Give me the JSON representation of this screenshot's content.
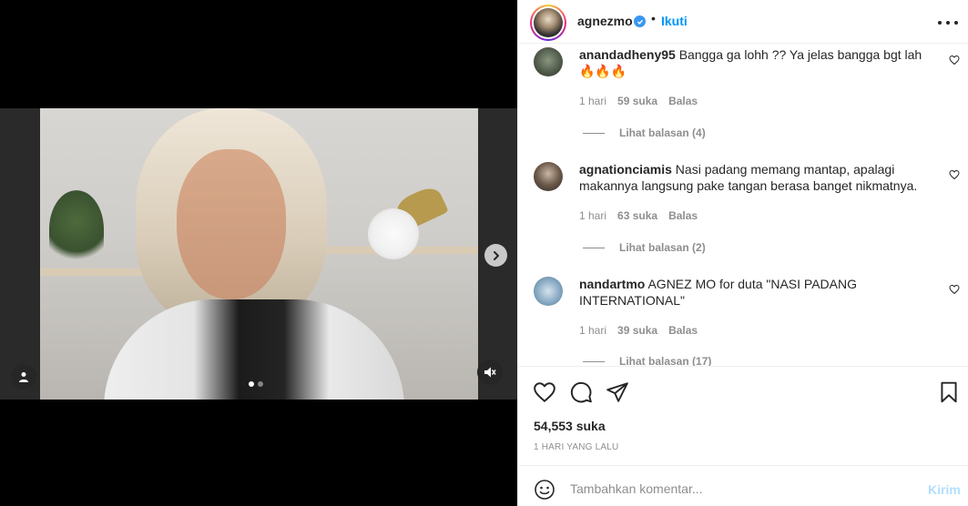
{
  "post": {
    "username": "agnezmo",
    "separator": "•",
    "follow_label": "Ikuti",
    "likes_label": "54,553 suka",
    "time_label": "1 HARI YANG LALU"
  },
  "comments": [
    {
      "username": "anandadheny95",
      "text": " Bangga ga lohh ?? Ya jelas bangga bgt lah 🔥🔥🔥",
      "time": "1 hari",
      "likes": "59 suka",
      "reply_label": "Balas",
      "view_replies": "Lihat balasan (4)"
    },
    {
      "username": "agnationciamis",
      "text": " Nasi padang memang mantap, apalagi makannya langsung pake tangan berasa banget nikmatnya.",
      "time": "1 hari",
      "likes": "63 suka",
      "reply_label": "Balas",
      "view_replies": "Lihat balasan (2)"
    },
    {
      "username": "nandartmo",
      "text": " AGNEZ MO for duta \"NASI PADANG INTERNATIONAL\"",
      "time": "1 hari",
      "likes": "39 suka",
      "reply_label": "Balas",
      "view_replies": "Lihat balasan (17)"
    }
  ],
  "composer": {
    "placeholder": "Tambahkan komentar...",
    "post_label": "Kirim"
  },
  "media": {
    "carousel_total": 2,
    "carousel_active": 1
  },
  "colors": {
    "accent": "#0095f6",
    "verified": "#3897f0",
    "muted": "#8e8e8e",
    "post_disabled": "#b2dffc"
  },
  "icons": [
    "heart-icon",
    "comment-icon",
    "share-icon",
    "bookmark-icon",
    "emoji-icon",
    "more-icon",
    "verified-icon",
    "chevron-right-icon",
    "user-tag-icon",
    "muted-audio-icon"
  ]
}
